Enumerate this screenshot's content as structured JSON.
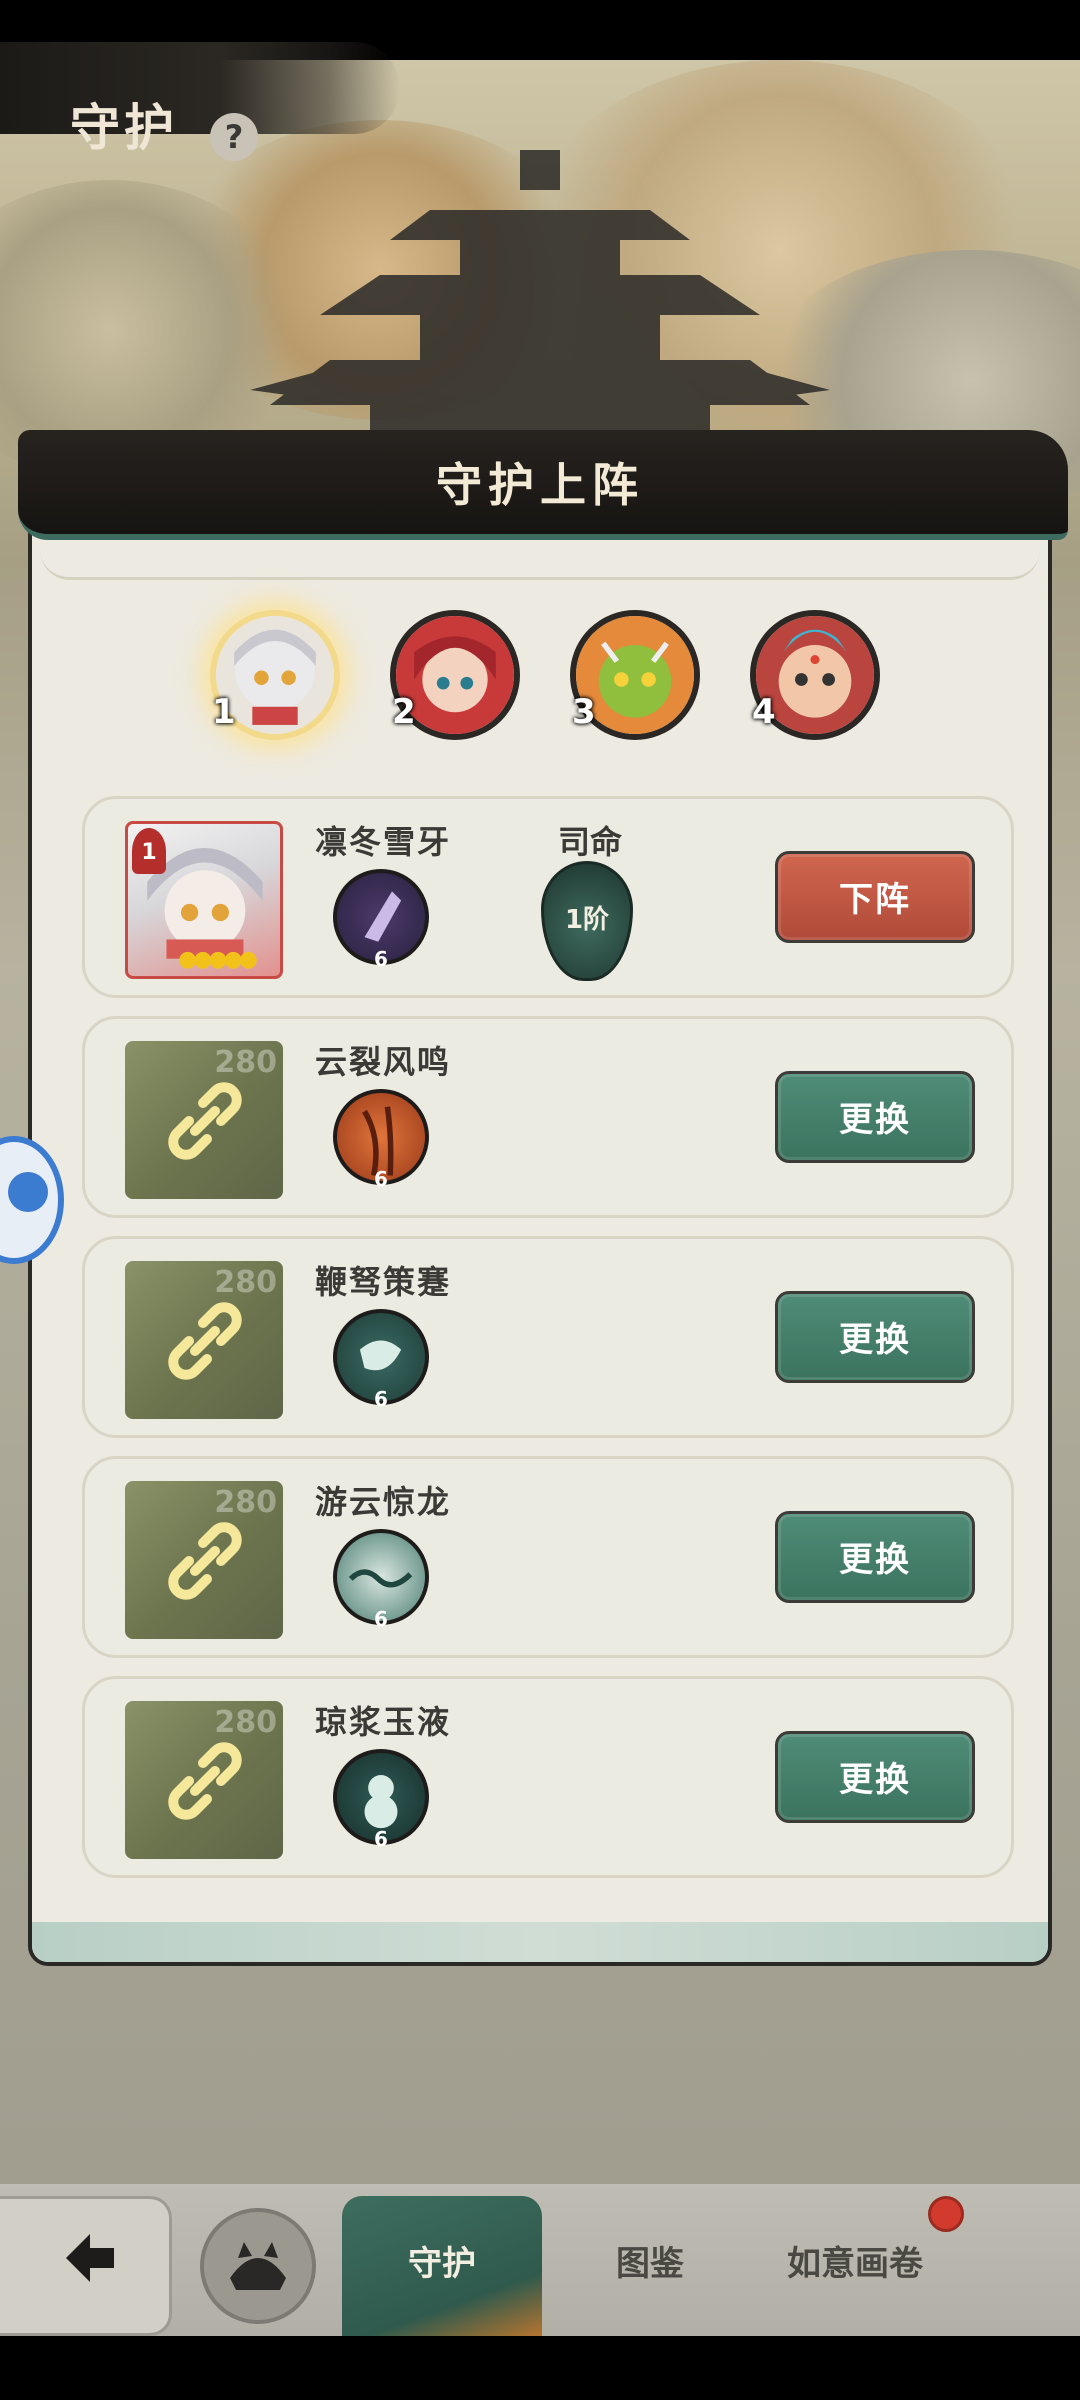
{
  "page": {
    "title": "守护",
    "help": "?"
  },
  "panel": {
    "title": "守护上阵"
  },
  "team": [
    {
      "number": "1",
      "selected": true
    },
    {
      "number": "2",
      "selected": false
    },
    {
      "number": "3",
      "selected": false
    },
    {
      "number": "4",
      "selected": false
    }
  ],
  "rows": [
    {
      "name": "凛冬雪牙",
      "skill_level": "6",
      "destiny_label": "司命",
      "destiny_value": "1阶",
      "rank": "1",
      "button": "下阵",
      "locked": false
    },
    {
      "name": "云裂风鸣",
      "skill_level": "6",
      "lock_number": "280",
      "button": "更换",
      "locked": true
    },
    {
      "name": "鞭驽策蹇",
      "skill_level": "6",
      "lock_number": "280",
      "button": "更换",
      "locked": true
    },
    {
      "name": "游云惊龙",
      "skill_level": "6",
      "lock_number": "280",
      "button": "更换",
      "locked": true
    },
    {
      "name": "琼浆玉液",
      "skill_level": "6",
      "lock_number": "280",
      "button": "更换",
      "locked": true
    }
  ],
  "tabs": {
    "guard": "守护",
    "codex": "图鉴",
    "scroll": "如意画卷"
  },
  "colors": {
    "accent_green": "#3b735f",
    "remove_red": "#b04a38",
    "badge_red": "#d23a2d"
  },
  "icons": {
    "back": "back-arrow-icon",
    "shop": "cat-icon",
    "help": "help-icon",
    "chain": "chain-icon"
  }
}
